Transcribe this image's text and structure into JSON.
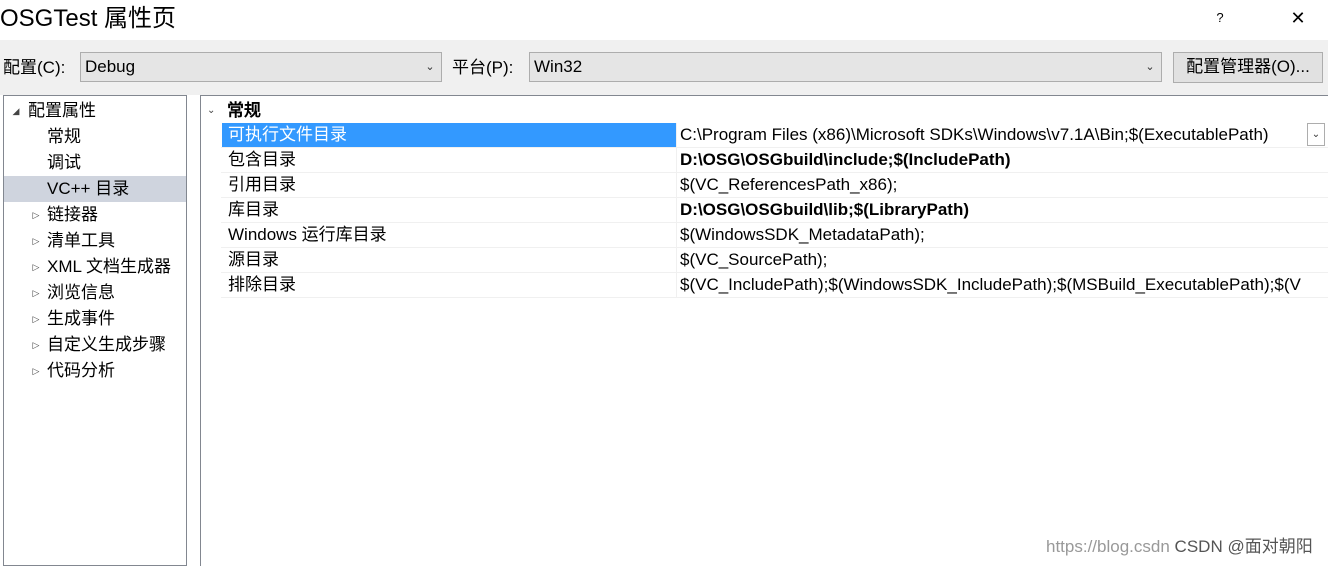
{
  "window": {
    "title": "OSGTest 属性页",
    "help_label": "?",
    "close_label": "✕"
  },
  "toolbar": {
    "config_label": "配置(C):",
    "config_value": "Debug",
    "platform_label": "平台(P):",
    "platform_value": "Win32",
    "config_manager_label": "配置管理器(O)..."
  },
  "tree": {
    "root": "配置属性",
    "items": [
      {
        "label": "常规",
        "expandable": false,
        "selected": false
      },
      {
        "label": "调试",
        "expandable": false,
        "selected": false
      },
      {
        "label": "VC++ 目录",
        "expandable": false,
        "selected": true
      },
      {
        "label": "链接器",
        "expandable": true,
        "selected": false
      },
      {
        "label": "清单工具",
        "expandable": true,
        "selected": false
      },
      {
        "label": "XML 文档生成器",
        "expandable": true,
        "selected": false
      },
      {
        "label": "浏览信息",
        "expandable": true,
        "selected": false
      },
      {
        "label": "生成事件",
        "expandable": true,
        "selected": false
      },
      {
        "label": "自定义生成步骤",
        "expandable": true,
        "selected": false
      },
      {
        "label": "代码分析",
        "expandable": true,
        "selected": false
      }
    ]
  },
  "grid": {
    "category": "常规",
    "rows": [
      {
        "name": "可执行文件目录",
        "value": "C:\\Program Files (x86)\\Microsoft SDKs\\Windows\\v7.1A\\Bin;$(ExecutablePath)",
        "bold": false,
        "selected": true
      },
      {
        "name": "包含目录",
        "value": "D:\\OSG\\OSGbuild\\include;$(IncludePath)",
        "bold": true,
        "selected": false
      },
      {
        "name": "引用目录",
        "value": "$(VC_ReferencesPath_x86);",
        "bold": false,
        "selected": false
      },
      {
        "name": "库目录",
        "value": "D:\\OSG\\OSGbuild\\lib;$(LibraryPath)",
        "bold": true,
        "selected": false
      },
      {
        "name": "Windows 运行库目录",
        "value": "$(WindowsSDK_MetadataPath);",
        "bold": false,
        "selected": false
      },
      {
        "name": "源目录",
        "value": "$(VC_SourcePath);",
        "bold": false,
        "selected": false
      },
      {
        "name": "排除目录",
        "value": "$(VC_IncludePath);$(WindowsSDK_IncludePath);$(MSBuild_ExecutablePath);$(V",
        "bold": false,
        "selected": false
      }
    ]
  },
  "watermark": {
    "url": "https://blog.csdn",
    "brand": "CSDN @面对朝阳"
  },
  "colors": {
    "selection": "#3399ff",
    "tree_selection": "#cfd4de",
    "chrome": "#f0f0f0"
  }
}
